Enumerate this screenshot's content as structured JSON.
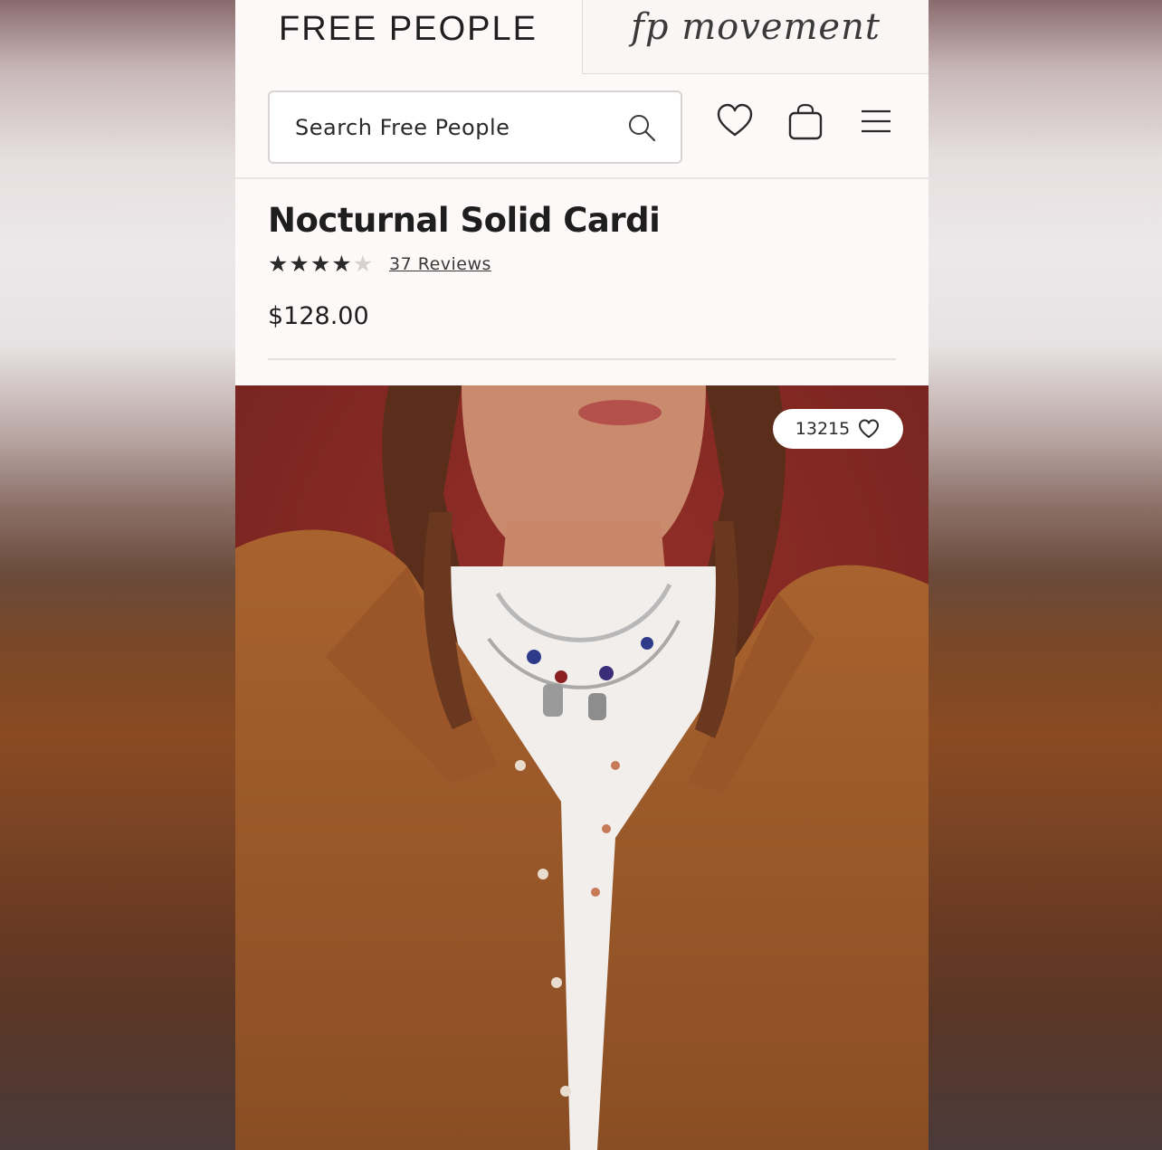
{
  "header": {
    "brand_left": "FREE PEOPLE",
    "brand_right": "fp movement"
  },
  "search": {
    "placeholder": "Search Free People",
    "icon": "search-icon"
  },
  "actions": {
    "wishlist_icon": "heart-icon",
    "bag_icon": "shopping-bag-icon",
    "menu_icon": "hamburger-menu-icon"
  },
  "product": {
    "title": "Nocturnal Solid Cardi",
    "rating": 4,
    "rating_max": 5,
    "reviews_label": "37 Reviews",
    "price": "$128.00"
  },
  "image": {
    "like_count": "13215",
    "like_icon": "heart-icon"
  },
  "colors": {
    "background_image": "#8a2e28",
    "cardigan": "#9c5a2c",
    "text": "#1e1e1e"
  }
}
